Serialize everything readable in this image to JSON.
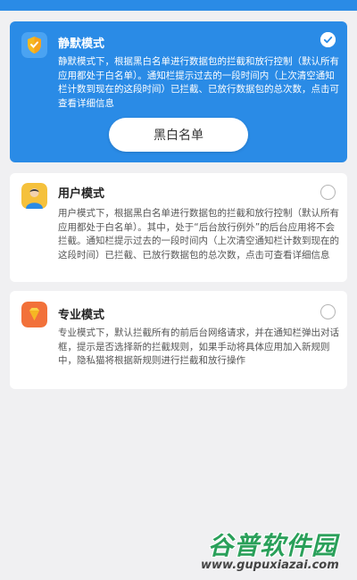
{
  "colors": {
    "accent": "#2a8be6",
    "background": "#f0f0f2",
    "watermark_green": "#2aa05a"
  },
  "modes": {
    "quiet": {
      "title": "静默模式",
      "description": "静默模式下，根据黑白名单进行数据包的拦截和放行控制（默认所有应用都处于白名单）。通知栏提示过去的一段时间内（上次清空通知栏计数到现在的这段时间）已拦截、已放行数据包的总次数，点击可查看详细信息",
      "button_label": "黑白名单",
      "selected": true,
      "icon": "shield-icon"
    },
    "user": {
      "title": "用户模式",
      "description": "用户模式下，根据黑白名单进行数据包的拦截和放行控制（默认所有应用都处于白名单）。其中，处于“后台放行例外”的后台应用将不会拦截。通知栏提示过去的一段时间内（上次清空通知栏计数到现在的这段时间）已拦截、已放行数据包的总次数，点击可查看详细信息",
      "selected": false,
      "icon": "person-icon"
    },
    "pro": {
      "title": "专业模式",
      "description": "专业模式下，默认拦截所有的前后台网络请求，并在通知栏弹出对话框，提示是否选择新的拦截规则，如果手动将具体应用加入新规则中，隐私猫将根据新规则进行拦截和放行操作",
      "selected": false,
      "icon": "diamond-icon"
    }
  },
  "watermark": {
    "title": "谷普软件园",
    "url": "www.gupuxiazai.com"
  }
}
